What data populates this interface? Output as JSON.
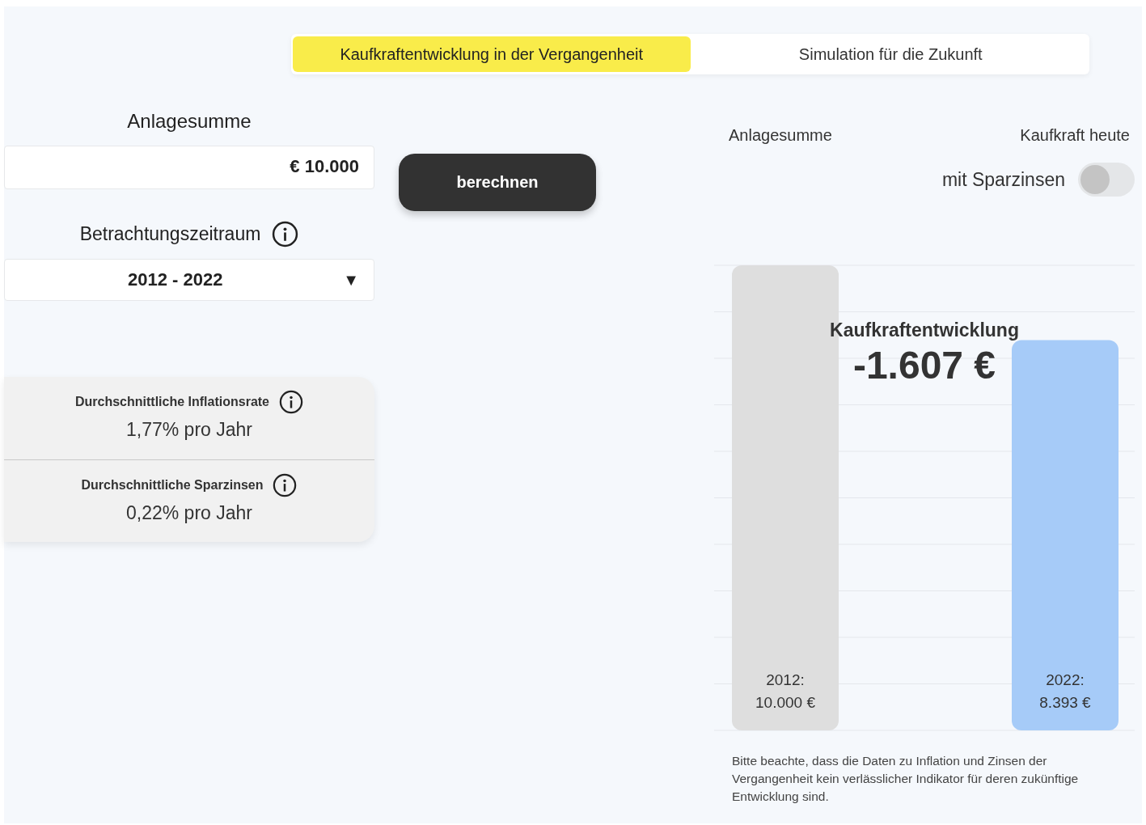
{
  "tabs": [
    {
      "label": "Kaufkraftentwicklung in der Vergangenheit",
      "selected": true
    },
    {
      "label": "Simulation für die Zukunft",
      "selected": false
    }
  ],
  "amount": {
    "label": "Anlagesumme",
    "value": "€ 10.000"
  },
  "period": {
    "label": "Betrachtungszeitraum",
    "value": "2012 - 2022",
    "caret": "▼"
  },
  "calculate_button": "berechnen",
  "stats": [
    {
      "label": "Durchschnittliche Inflationsrate",
      "value": "1,77% pro Jahr"
    },
    {
      "label": "Durchschnittliche Sparzinsen",
      "value": "0,22% pro Jahr"
    }
  ],
  "chart_header": {
    "left": "Anlagesumme",
    "right": "Kaufkraft heute"
  },
  "savings_toggle": {
    "label": "mit Sparzinsen",
    "on": false
  },
  "result": {
    "title": "Kaufkraftentwicklung",
    "value": "-1.607 €"
  },
  "chart_data": {
    "type": "bar",
    "categories": [
      "2012",
      "2022"
    ],
    "values": [
      10000,
      8393
    ],
    "value_labels": [
      "10.000 €",
      "8.393 €"
    ]
  },
  "category_suffix": ":",
  "disclaimer": "Bitte beachte, dass die Daten zu Inflation und Zinsen der Vergangenheit kein verlässlicher Indikator für deren zukünftige Entwicklung sind."
}
